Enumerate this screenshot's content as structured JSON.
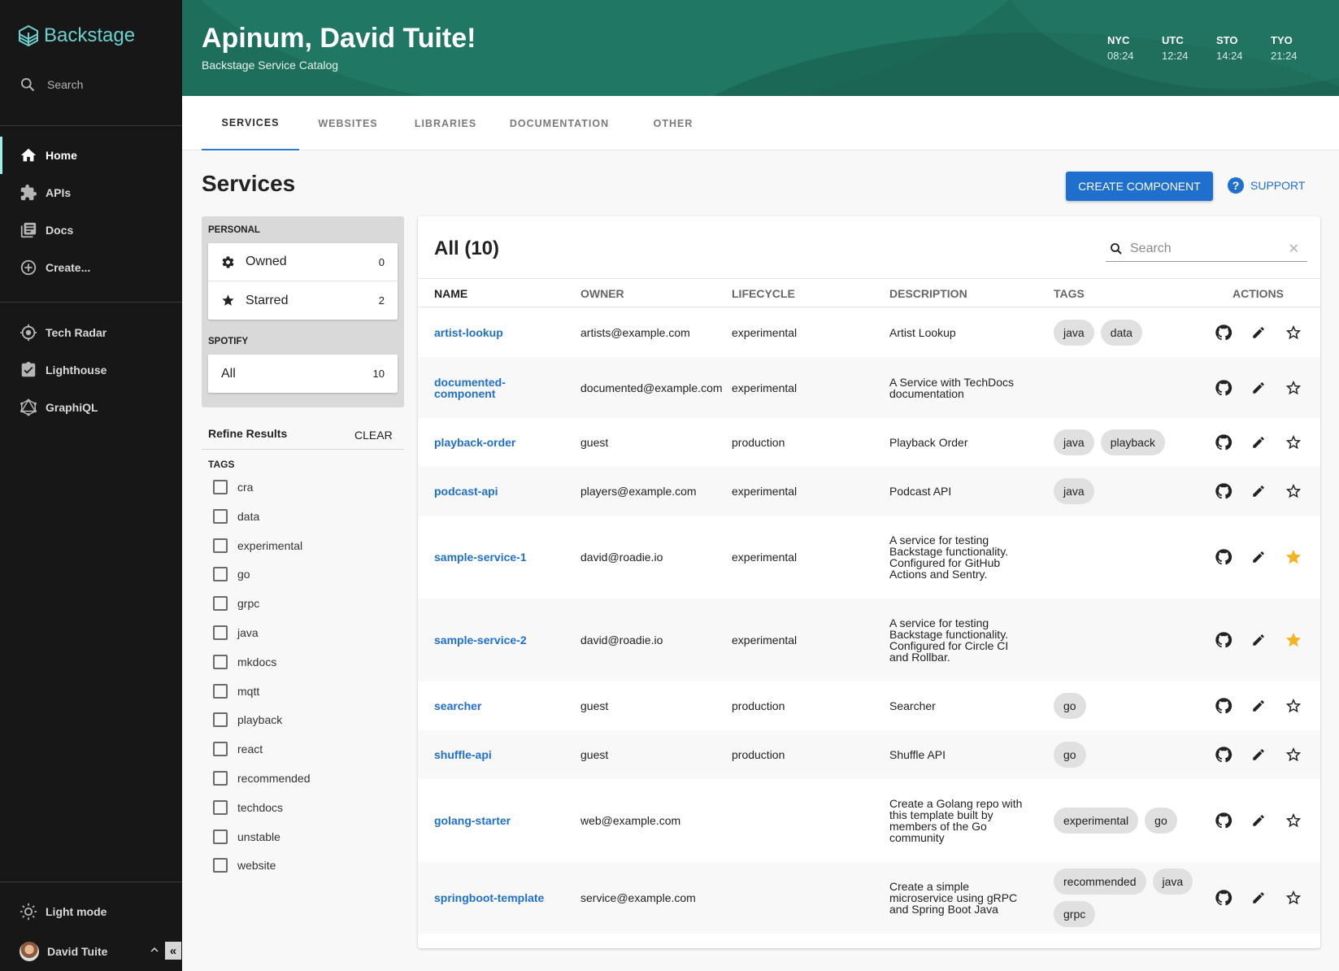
{
  "sidebar": {
    "logo": "Backstage",
    "search_label": "Search",
    "items": [
      {
        "label": "Home",
        "icon": "home-icon"
      },
      {
        "label": "APIs",
        "icon": "puzzle-icon"
      },
      {
        "label": "Docs",
        "icon": "docs-icon"
      },
      {
        "label": "Create...",
        "icon": "add-circle-icon"
      },
      {
        "label": "Tech Radar",
        "icon": "radar-icon"
      },
      {
        "label": "Lighthouse",
        "icon": "assignment-check-icon"
      },
      {
        "label": "GraphiQL",
        "icon": "graphql-icon"
      }
    ],
    "light_mode": "Light mode",
    "user": "David Tuite"
  },
  "header": {
    "title": "Apinum, David Tuite!",
    "subtitle": "Backstage Service Catalog",
    "clocks": [
      {
        "label": "NYC",
        "time": "08:24"
      },
      {
        "label": "UTC",
        "time": "12:24"
      },
      {
        "label": "STO",
        "time": "14:24"
      },
      {
        "label": "TYO",
        "time": "21:24"
      }
    ]
  },
  "tabs": [
    "SERVICES",
    "WEBSITES",
    "LIBRARIES",
    "DOCUMENTATION",
    "OTHER"
  ],
  "page": {
    "title": "Services",
    "create_button": "CREATE COMPONENT",
    "support": "SUPPORT"
  },
  "filters": {
    "personal_header": "PERSONAL",
    "owned_label": "Owned",
    "owned_count": "0",
    "starred_label": "Starred",
    "starred_count": "2",
    "org_header": "SPOTIFY",
    "all_label": "All",
    "all_count": "10",
    "refine_label": "Refine Results",
    "clear_label": "CLEAR",
    "tags_header": "TAGS",
    "tags": [
      "cra",
      "data",
      "experimental",
      "go",
      "grpc",
      "java",
      "mkdocs",
      "mqtt",
      "playback",
      "react",
      "recommended",
      "techdocs",
      "unstable",
      "website"
    ]
  },
  "table": {
    "title": "All (10)",
    "search_placeholder": "Search",
    "columns": [
      "NAME",
      "OWNER",
      "LIFECYCLE",
      "DESCRIPTION",
      "TAGS",
      "ACTIONS"
    ],
    "rows": [
      {
        "name": "artist-lookup",
        "owner": "artists@example.com",
        "lifecycle": "experimental",
        "description": "Artist Lookup",
        "tags": [
          "java",
          "data"
        ],
        "starred": false
      },
      {
        "name": "documented-component",
        "owner": "documented@example.com",
        "lifecycle": "experimental",
        "description": "A Service with TechDocs documentation",
        "tags": [],
        "starred": false
      },
      {
        "name": "playback-order",
        "owner": "guest",
        "lifecycle": "production",
        "description": "Playback Order",
        "tags": [
          "java",
          "playback"
        ],
        "starred": false
      },
      {
        "name": "podcast-api",
        "owner": "players@example.com",
        "lifecycle": "experimental",
        "description": "Podcast API",
        "tags": [
          "java"
        ],
        "starred": false
      },
      {
        "name": "sample-service-1",
        "owner": "david@roadie.io",
        "lifecycle": "experimental",
        "description": "A service for testing Backstage functionality. Configured for GitHub Actions and Sentry.",
        "tags": [],
        "starred": true
      },
      {
        "name": "sample-service-2",
        "owner": "david@roadie.io",
        "lifecycle": "experimental",
        "description": "A service for testing Backstage functionality. Configured for Circle CI and Rollbar.",
        "tags": [],
        "starred": true
      },
      {
        "name": "searcher",
        "owner": "guest",
        "lifecycle": "production",
        "description": "Searcher",
        "tags": [
          "go"
        ],
        "starred": false
      },
      {
        "name": "shuffle-api",
        "owner": "guest",
        "lifecycle": "production",
        "description": "Shuffle API",
        "tags": [
          "go"
        ],
        "starred": false
      },
      {
        "name": "golang-starter",
        "owner": "web@example.com",
        "lifecycle": "",
        "description": "Create a Golang repo with this template built by members of the Go community",
        "tags": [
          "experimental",
          "go"
        ],
        "starred": false
      },
      {
        "name": "springboot-template",
        "owner": "service@example.com",
        "lifecycle": "",
        "description": "Create a simple microservice using gRPC and Spring Boot Java",
        "tags": [
          "recommended",
          "java",
          "grpc"
        ],
        "starred": false
      }
    ]
  },
  "colors": {
    "sidebar": "#171717",
    "header": "#1e6e5c",
    "accent": "#1f6fcf",
    "star": "#f5b324"
  }
}
